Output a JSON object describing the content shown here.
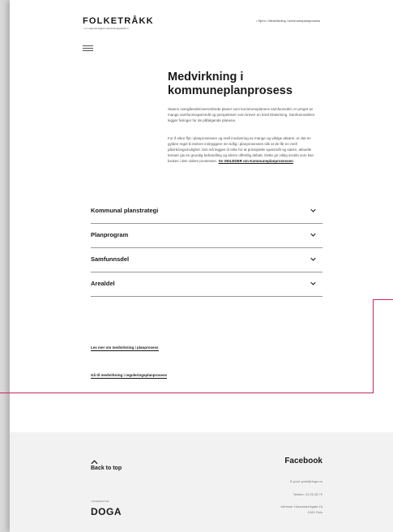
{
  "header": {
    "logo": "FOLKETRÅKK",
    "tagline": "– en nasjonal digital medvirkningsplattform",
    "breadcrumb": "/ Hjem / Medvirkning i kommuneplanprosess"
  },
  "main": {
    "title": "Medvirkning i kommuneplanprosess",
    "intro": "Staens overgående/overordnede planer som kommuneplanens samfunnsdel, er preget av mange samfunnsspørsmål og perspektiver som krever en bred tilnærming. Samfunnsdelen legger føringer for de påfølgende planene.",
    "body": "For å sikre flyt i planprosessen og reell involvering av mange og viktige aktører, er det en gylden regel å invitere innbyggere inn tidlig i planprosessen slik at de får en reell påvirkningsmulighet. Det må legges til rette for at prinsipielle spørsmål og større, aktuelle temaer gis en grundig behandling og sikres offentlig debatt. Dette gir viktig innsikt som kan brukes i den videre prosessen.",
    "guide_link": "Se VEILEDER om Kommuneplanprosessen"
  },
  "accordion": [
    {
      "label": "Kommunal planstrategi"
    },
    {
      "label": "Planprogram"
    },
    {
      "label": "Samfunnsdel"
    },
    {
      "label": "Arealdel"
    }
  ],
  "links": {
    "more": "Les mer om medvirkning i planprosess",
    "goto": "Gå til medvirkning i reguleringsplanprosess"
  },
  "footer": {
    "back_to_top": "Back to top",
    "partner_label": "I samarbeid med",
    "partner": "DOGA",
    "facebook": "Facebook",
    "email": "E-post: post@doga.no",
    "phone": "Telefon: 23 29 28 70",
    "address1": "Adresse: Hausmannsgate 16",
    "address2": "0182 Oslo"
  },
  "colors": {
    "accent_line": "#c8285a",
    "footer_bg": "#f2f2f2"
  }
}
